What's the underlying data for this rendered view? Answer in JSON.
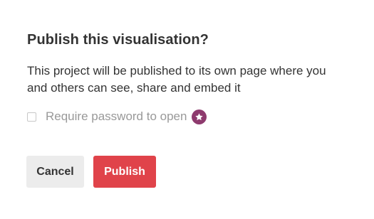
{
  "dialog": {
    "title": "Publish this visualisation?",
    "description": "This project will be published to its own page where you and others can see, share and embed it",
    "password_option": {
      "label": "Require password to open",
      "checked": false,
      "badge_icon": "star-icon",
      "badge_color": "#8e3a6e"
    },
    "buttons": {
      "cancel_label": "Cancel",
      "publish_label": "Publish"
    }
  },
  "colors": {
    "cancel_bg": "#ececec",
    "publish_bg": "#e0434a",
    "muted_text": "#999999"
  }
}
